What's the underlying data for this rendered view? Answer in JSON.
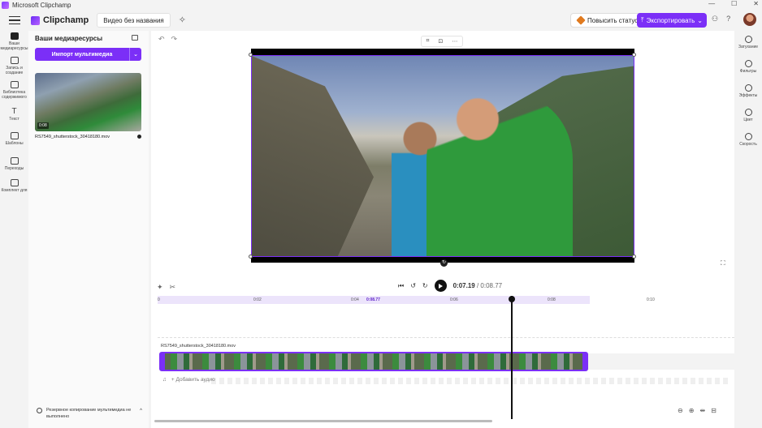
{
  "window": {
    "title": "Microsoft Clipchamp",
    "controls": [
      "—",
      "☐",
      "✕"
    ]
  },
  "header": {
    "app_name": "Clipchamp",
    "project_name": "Видео без названия",
    "upgrade_label": "Повысить статус",
    "export_label": "Экспортировать",
    "export_icon": "⤒",
    "export_chevron": "⌄",
    "icons": [
      "⚇",
      "?"
    ]
  },
  "left_nav": {
    "items": [
      {
        "label": "Ваши медиаресурсы",
        "active": true
      },
      {
        "label": "Запись и создание",
        "active": false
      },
      {
        "label": "Библиотека содержимого",
        "active": false
      },
      {
        "label": "Текст",
        "active": false
      },
      {
        "label": "Шаблоны",
        "active": false
      },
      {
        "label": "Переходы",
        "active": false
      },
      {
        "label": "Комплект для",
        "active": false
      }
    ]
  },
  "media_panel": {
    "title": "Ваши медиаресурсы",
    "import_label": "Импорт мультимедиа",
    "import_chevron": "⌄",
    "thumb_duration": "0:08",
    "file_name": "RS7549_shutterstock_30418180.mov",
    "backup_text": "Резервное копирование мультимедиа не выполнено",
    "backup_chevron": "^"
  },
  "editor": {
    "undo": "↶",
    "redo": "↷",
    "canvas_toolbar": [
      "⌗",
      "⊡",
      "⋯"
    ],
    "rotate": "↻",
    "fullscreen": "⛶",
    "timeline_tools": [
      "✦",
      "✂"
    ],
    "playback_icons": [
      "⏮",
      "↺",
      "↻"
    ],
    "current_time": "0:07.19",
    "separator": " / ",
    "total_time": "0:08.77",
    "ruler": [
      {
        "label": "0"
      },
      {
        "label": "0:02"
      },
      {
        "label": "0:04"
      },
      {
        "label": "0:08.77",
        "highlight": true
      },
      {
        "label": "0:06"
      },
      {
        "label": "0:08"
      },
      {
        "label": "0:10"
      }
    ],
    "track_label": "RS7549_shutterstock_30418180.mov",
    "add_audio_icon": "♫",
    "add_audio_label": "+ Добавить аудио",
    "zoom_tools": [
      "⊖",
      "⊕",
      "⇹",
      "⊟"
    ]
  },
  "right_nav": {
    "items": [
      {
        "label": "Затухание"
      },
      {
        "label": "Фильтры"
      },
      {
        "label": "Эффекты"
      },
      {
        "label": "Цвет"
      },
      {
        "label": "Скорость"
      }
    ]
  }
}
